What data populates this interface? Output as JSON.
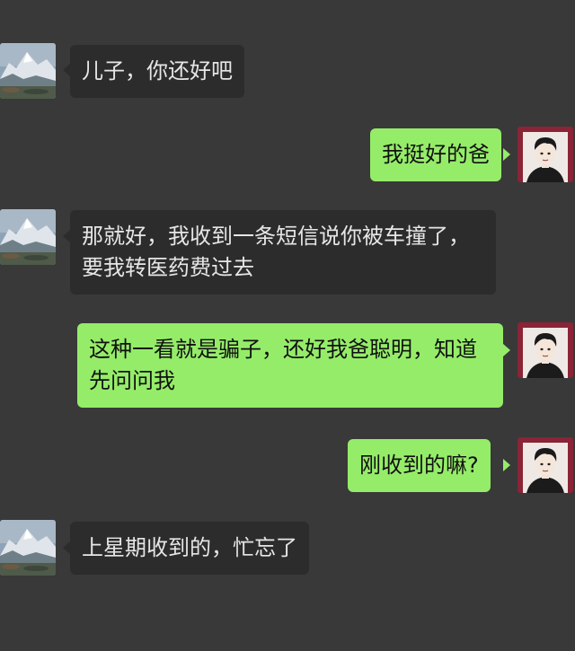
{
  "chat": {
    "messages": [
      {
        "side": "left",
        "sender": "dad",
        "text": "儿子，你还好吧"
      },
      {
        "side": "right",
        "sender": "son",
        "text": "我挺好的爸"
      },
      {
        "side": "left",
        "sender": "dad",
        "line1": "那就好，我收到一条短信说你被车撞了，",
        "line2": "要我转医药费过去"
      },
      {
        "side": "right",
        "sender": "son",
        "line1": "这种一看就是骗子，还好我爸聪明，知道",
        "line2": "先问问我"
      },
      {
        "side": "right",
        "sender": "son",
        "text": "刚收到的嘛?"
      },
      {
        "side": "left",
        "sender": "dad",
        "text": "上星期收到的，忙忘了"
      }
    ]
  },
  "colors": {
    "background": "#393939",
    "incoming_bubble": "#2c2c2c",
    "outgoing_bubble": "#95ec69"
  }
}
